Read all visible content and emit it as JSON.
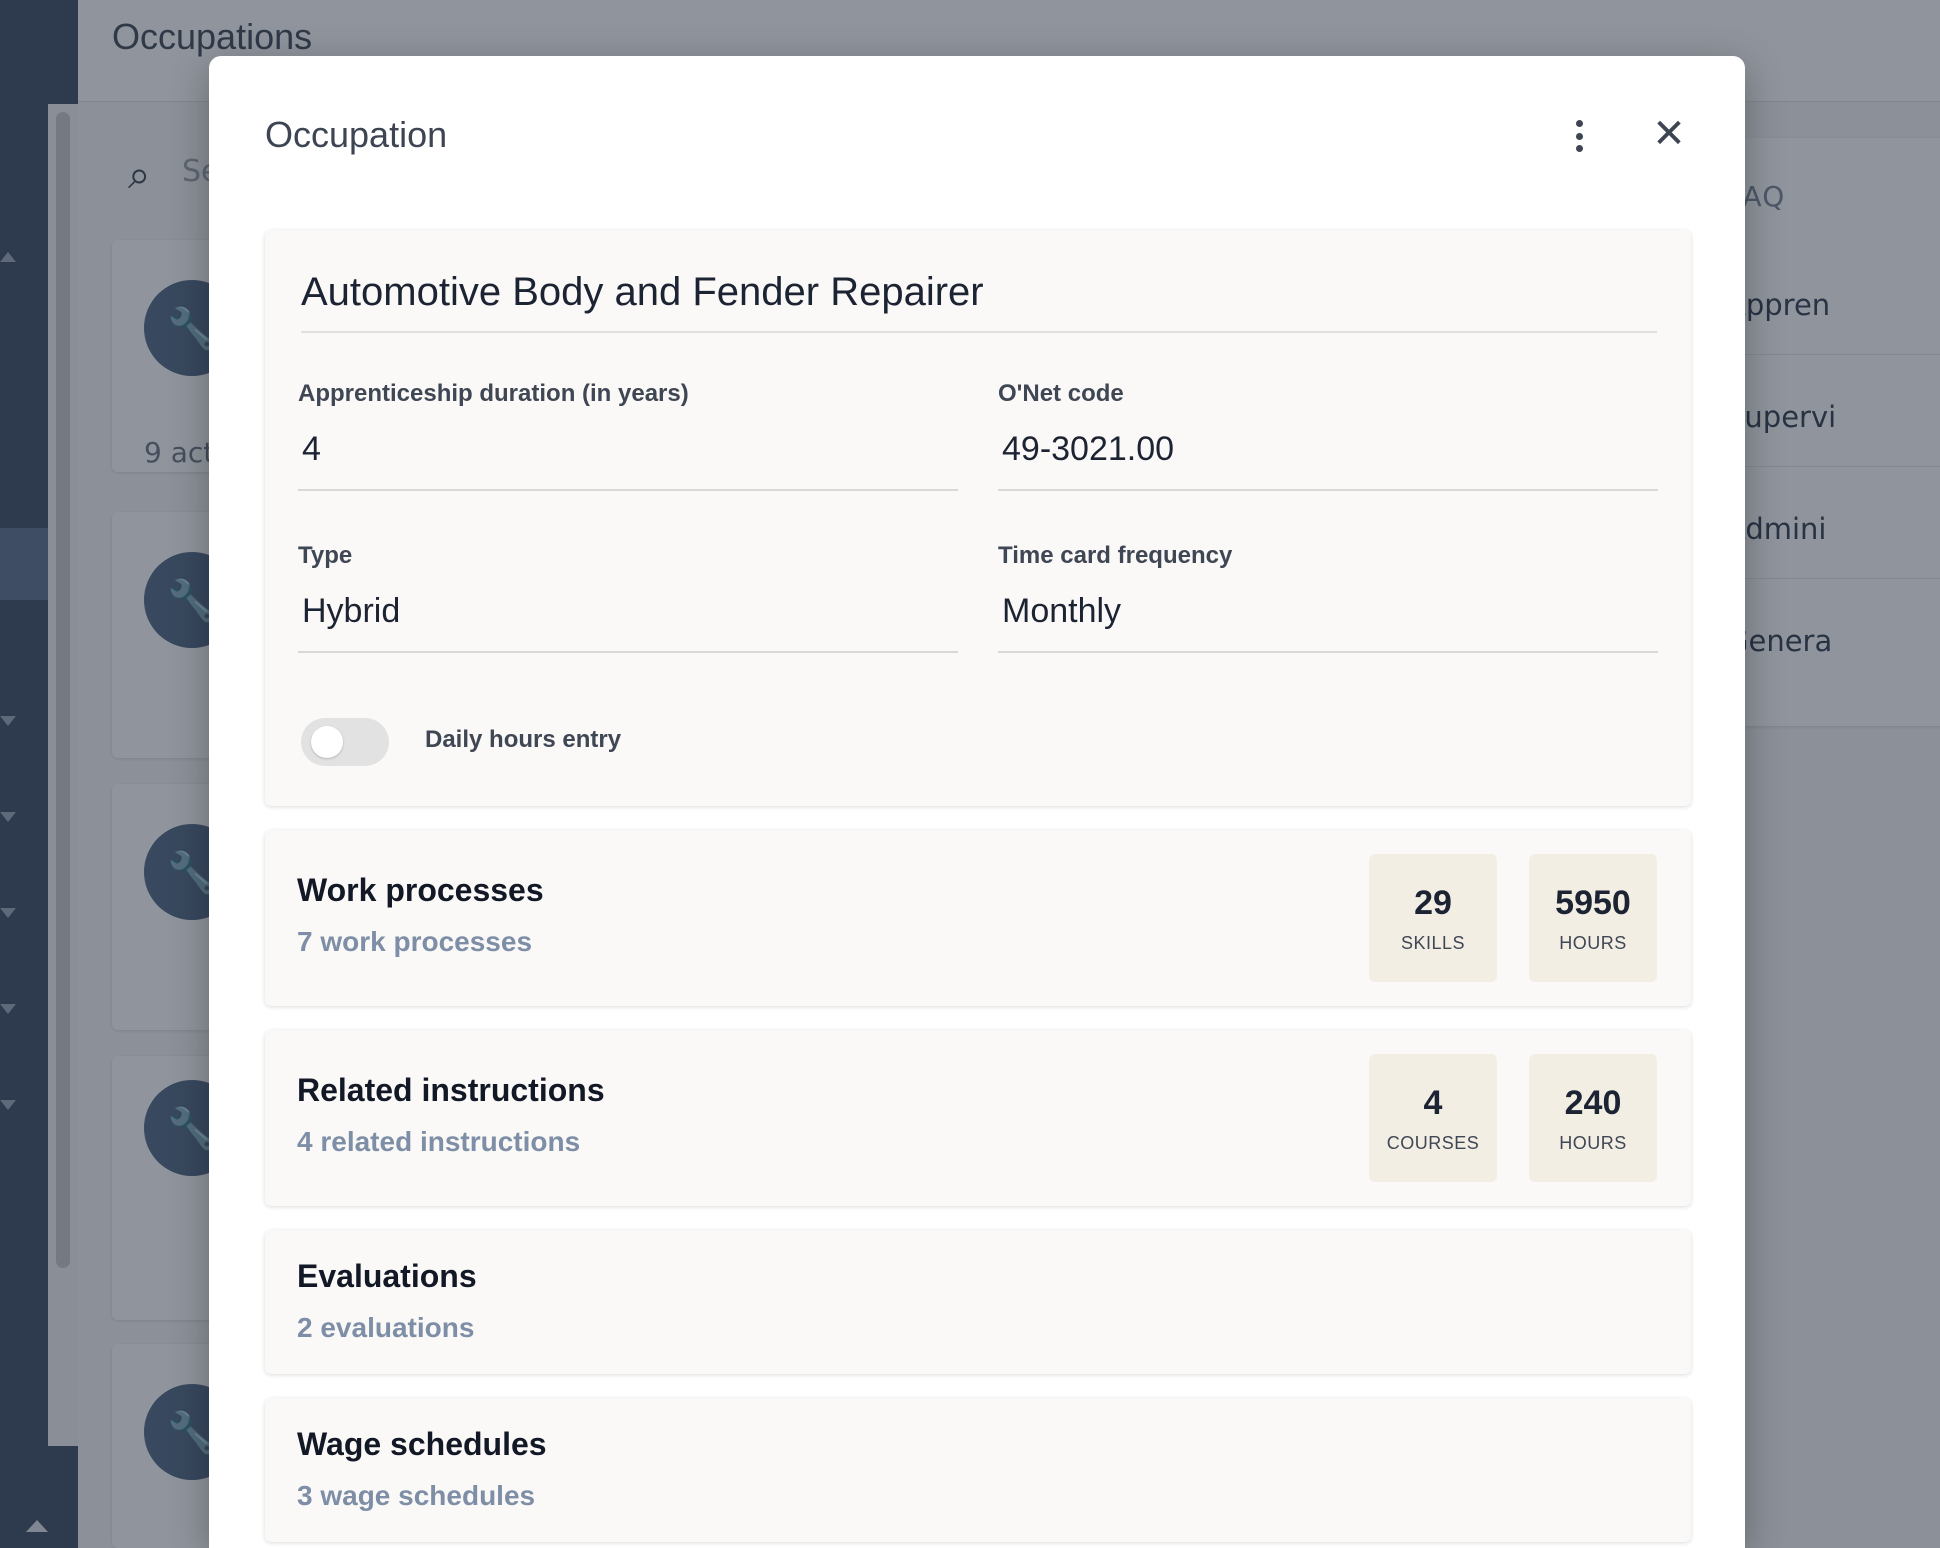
{
  "app": {
    "title": "Occupations",
    "search_placeholder": "Se",
    "search_icon": "search-icon",
    "card_icon": "wrench-icon",
    "first_card_text": "9 act"
  },
  "faq": {
    "title": "FAQ",
    "items": [
      "Appren",
      "Supervi",
      "Admini",
      "Genera"
    ]
  },
  "modal": {
    "title": "Occupation",
    "more_icon": "more-vertical-icon",
    "close_icon": "close-icon",
    "close_glyph": "✕"
  },
  "occupation": {
    "name": "Automotive Body and Fender Repairer",
    "fields": {
      "duration": {
        "label": "Apprenticeship duration (in years)",
        "value": "4"
      },
      "onet": {
        "label": "O'Net code",
        "value": "49-3021.00"
      },
      "type": {
        "label": "Type",
        "value": "Hybrid"
      },
      "frequency": {
        "label": "Time card frequency",
        "value": "Monthly"
      }
    },
    "daily_hours": {
      "label": "Daily hours entry",
      "enabled": false
    }
  },
  "sections": {
    "work_processes": {
      "title": "Work processes",
      "subtitle": "7 work processes",
      "stats": [
        {
          "value": "29",
          "label": "SKILLS"
        },
        {
          "value": "5950",
          "label": "HOURS"
        }
      ]
    },
    "related_instructions": {
      "title": "Related instructions",
      "subtitle": "4 related instructions",
      "stats": [
        {
          "value": "4",
          "label": "COURSES"
        },
        {
          "value": "240",
          "label": "HOURS"
        }
      ]
    },
    "evaluations": {
      "title": "Evaluations",
      "subtitle": "2 evaluations"
    },
    "wage_schedules": {
      "title": "Wage schedules",
      "subtitle": "3 wage schedules"
    }
  },
  "colors": {
    "sidebar": "#3a4b61",
    "panel_bg": "#faf9f7",
    "stat_bg": "#f3eee4",
    "link": "#7d8ea6"
  }
}
